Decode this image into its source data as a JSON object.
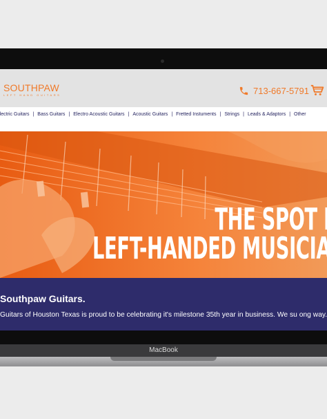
{
  "header": {
    "logo_main": "SOUTHPAW",
    "logo_sub": "LEFT HAND GUITARS",
    "phone": "713-667-5791"
  },
  "nav": {
    "items": [
      "Electric Guitars",
      "Bass Guitars",
      "Electro Acoustic Guitars",
      "Acoustic Guitars",
      "Fretted Instuments",
      "Strings",
      "Leads & Adaptors",
      "Other"
    ]
  },
  "hero": {
    "line1": "THE SPOT F",
    "line2": "LEFT-HANDED MUSICIA"
  },
  "welcome": {
    "title": "Southpaw Guitars.",
    "body": "y Guitars of Houston Texas is proud to be celebrating it's milestone 35th year in business. We su ong way..."
  },
  "device": {
    "label": "MacBook"
  },
  "colors": {
    "accent": "#f07a2a",
    "nav_text": "#24235f",
    "welcome_bg": "#2e2c6b"
  }
}
